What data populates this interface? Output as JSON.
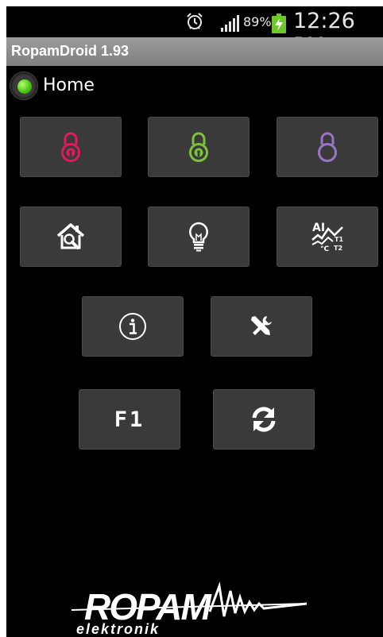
{
  "status_bar": {
    "battery_percent": "89%",
    "time": "12:26 PM",
    "icons": [
      "alarm-icon",
      "signal-icon",
      "battery-charging-icon"
    ]
  },
  "app": {
    "title": "RopamDroid 1.93"
  },
  "connection": {
    "label": "Home",
    "status_color": "#4cd011"
  },
  "tiles": {
    "arm_red": {
      "icon": "padlock-red-icon",
      "color": "#e3195b"
    },
    "arm_green": {
      "icon": "padlock-green-icon",
      "color": "#7cc23a"
    },
    "arm_purple": {
      "icon": "padlock-purple-icon",
      "color": "#9b74c8"
    },
    "zones": {
      "icon": "house-magnifier-icon"
    },
    "outputs": {
      "icon": "lightbulb-icon"
    },
    "analog": {
      "icon": "analog-temperature-chart-icon",
      "text_ai": "AI",
      "text_t1": "T1",
      "text_c": "°C",
      "text_t2": "T2"
    },
    "info": {
      "icon": "info-icon"
    },
    "settings": {
      "icon": "tools-icon"
    },
    "f1": {
      "label": "F1"
    },
    "refresh": {
      "icon": "refresh-icon"
    }
  },
  "logo": {
    "brand": "ROPAM",
    "sub": "elektronik"
  }
}
